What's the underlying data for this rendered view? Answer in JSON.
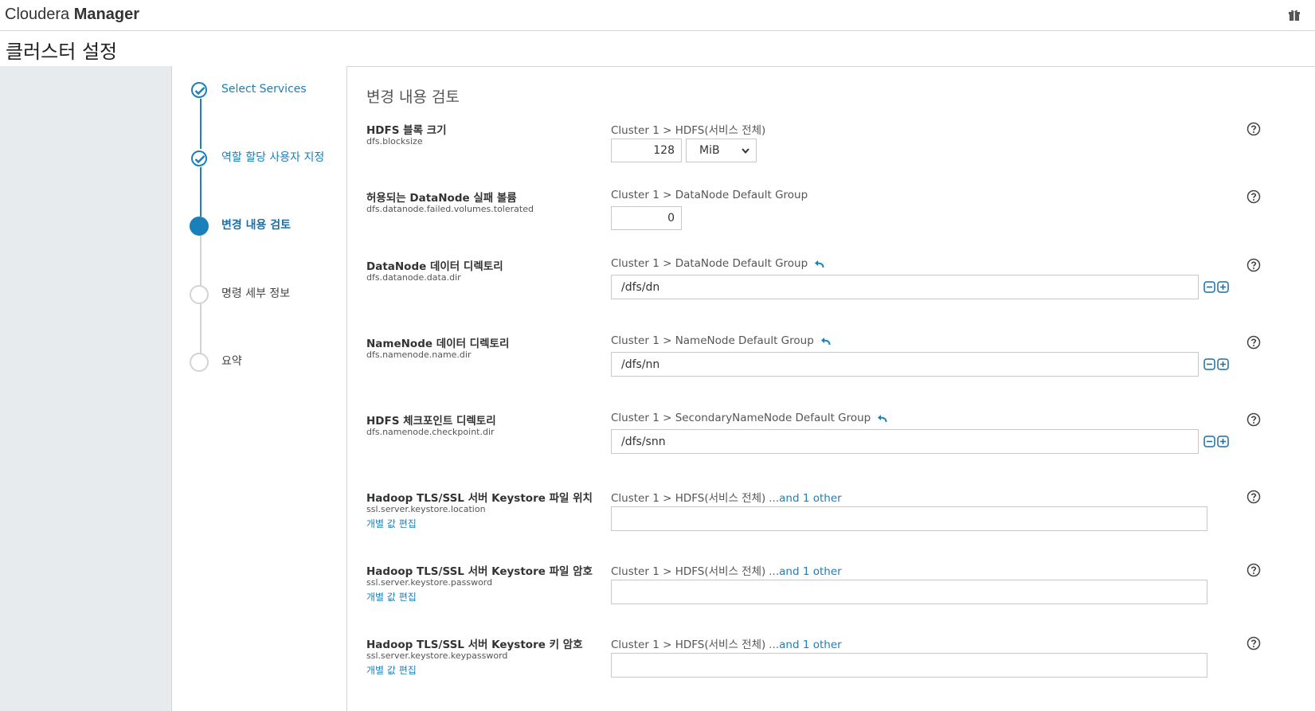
{
  "app": {
    "brand_light": "Cloudera",
    "brand_bold": "Manager",
    "page_title": "클러스터 설정"
  },
  "steps": [
    {
      "label": "Select Services",
      "state": "done"
    },
    {
      "label": "역할 할당 사용자 지정",
      "state": "done"
    },
    {
      "label": "변경 내용 검토",
      "state": "active"
    },
    {
      "label": "명령 세부 정보",
      "state": "todo"
    },
    {
      "label": "요약",
      "state": "todo"
    }
  ],
  "main": {
    "section_title": "변경 내용 검토",
    "rows": [
      {
        "name": "HDFS 블록 크기",
        "key": "dfs.blocksize",
        "scope": "Cluster 1 > HDFS(서비스 전체)",
        "value": "128",
        "unit": "MiB"
      },
      {
        "name": "허용되는 DataNode 실패 볼륨",
        "key": "dfs.datanode.failed.volumes.tolerated",
        "scope": "Cluster 1 > DataNode Default Group",
        "value": "0"
      },
      {
        "name": "DataNode 데이터 디렉토리",
        "key": "dfs.datanode.data.dir",
        "scope": "Cluster 1 > DataNode Default Group",
        "value": "/dfs/dn"
      },
      {
        "name": "NameNode 데이터 디렉토리",
        "key": "dfs.namenode.name.dir",
        "scope": "Cluster 1 > NameNode Default Group",
        "value": "/dfs/nn"
      },
      {
        "name": "HDFS 체크포인트 디렉토리",
        "key": "dfs.namenode.checkpoint.dir",
        "scope": "Cluster 1 > SecondaryNameNode Default Group",
        "value": "/dfs/snn"
      },
      {
        "name": "Hadoop TLS/SSL 서버 Keystore 파일 위치",
        "key": "ssl.server.keystore.location",
        "edit": "개별 값 편집",
        "scope": "Cluster 1 > HDFS(서비스 전체)",
        "other": "...and 1 other",
        "value": ""
      },
      {
        "name": "Hadoop TLS/SSL 서버 Keystore 파일 암호",
        "key": "ssl.server.keystore.password",
        "edit": "개별 값 편집",
        "scope": "Cluster 1 > HDFS(서비스 전체)",
        "other": "...and 1 other",
        "value": ""
      },
      {
        "name": "Hadoop TLS/SSL 서버 Keystore 키 암호",
        "key": "ssl.server.keystore.keypassword",
        "edit": "개별 값 편집",
        "scope": "Cluster 1 > HDFS(서비스 전체)",
        "other": "...and 1 other",
        "value": ""
      }
    ]
  },
  "icons": {
    "gift": "gift-icon",
    "help": "question-circle-icon",
    "undo": "undo-arrow-icon",
    "minus": "minus-square-icon",
    "plus": "plus-square-icon",
    "check": "check-icon"
  },
  "colors": {
    "accent": "#1b7fb9",
    "sidebar_bg": "#e8ebed"
  }
}
